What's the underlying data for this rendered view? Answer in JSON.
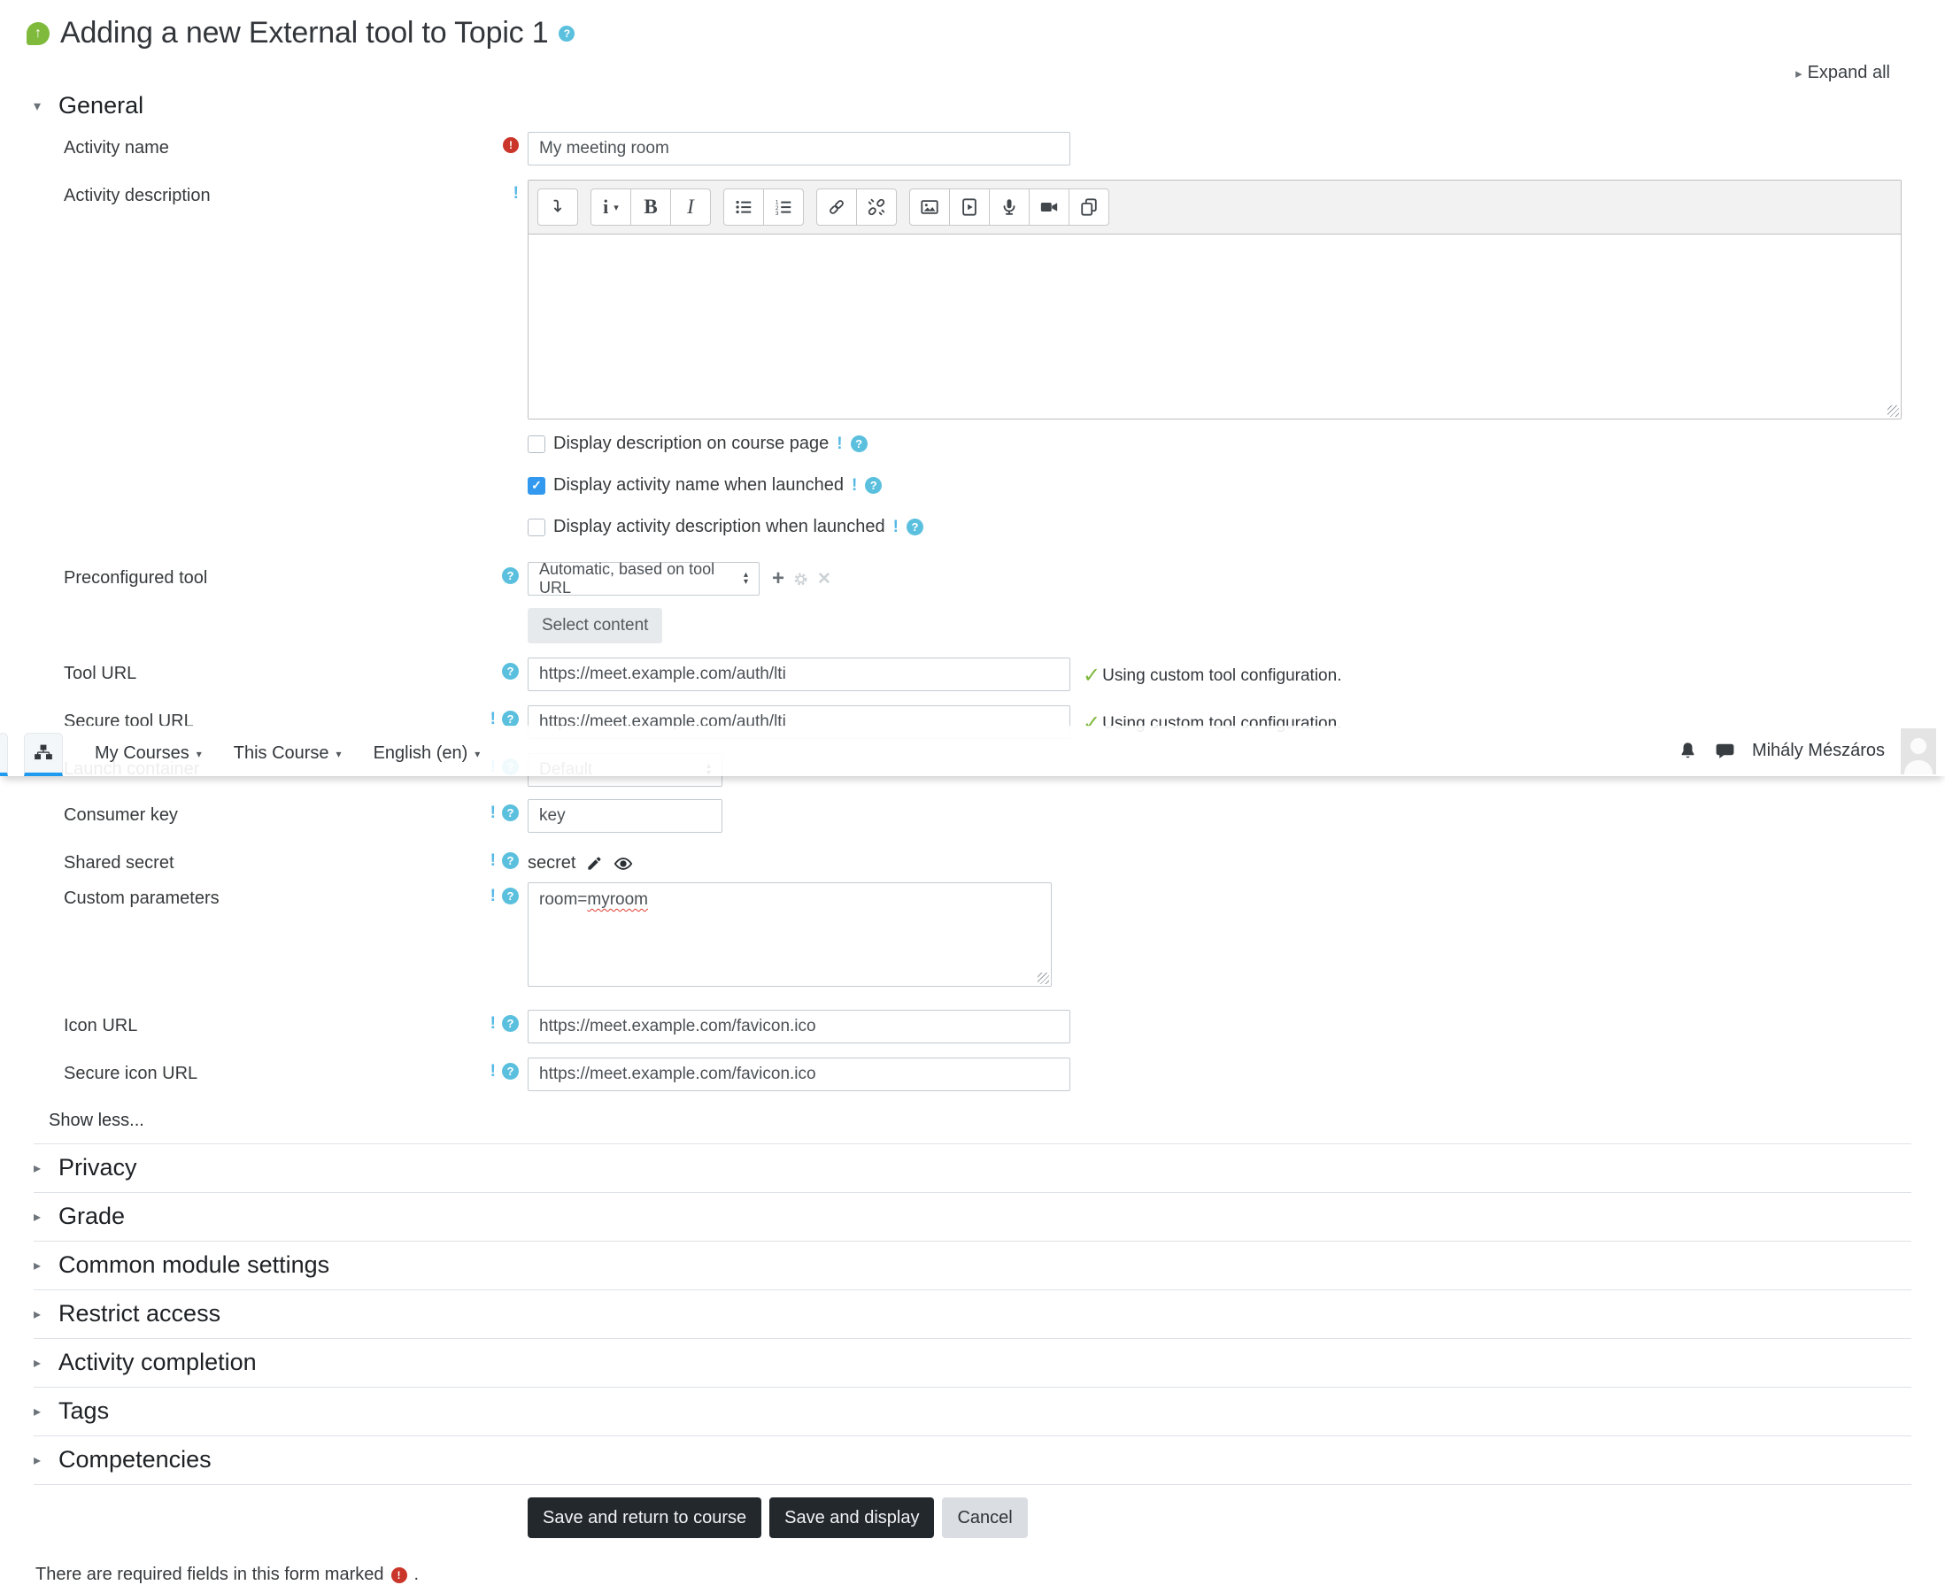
{
  "page": {
    "title": "Adding a new External tool to Topic 1",
    "expand_all": "Expand all",
    "show_less": "Show less...",
    "footer_required_prefix": "There are required fields in this form marked",
    "footer_suffix": "."
  },
  "icons": {
    "help": "?",
    "required": "!",
    "more": "!",
    "check": "✓",
    "checkbox_check": "✓",
    "plus": "+",
    "close": "✕",
    "caret": "▾",
    "triangle_collapsed": "▸",
    "triangle_expanded": "▾",
    "arrow_up_small": "▴",
    "arrow_down_small": "▾",
    "module_arrow": "↑"
  },
  "navbar": {
    "menus": [
      {
        "label": "My Courses"
      },
      {
        "label": "This Course"
      },
      {
        "label": "English (en)"
      }
    ],
    "user_name": "Mihály Mészáros"
  },
  "general": {
    "heading": "General",
    "activity_name": {
      "label": "Activity name",
      "value": "My meeting room"
    },
    "activity_description": {
      "label": "Activity description"
    },
    "editor": {
      "bold_glyph": "B",
      "italic_glyph": "I",
      "style_glyph": "i",
      "toolbar_icons": [
        "toggle-toolbar",
        "text-style",
        "bold",
        "italic",
        "unordered-list",
        "ordered-list",
        "link",
        "unlink",
        "image",
        "media",
        "record-audio",
        "record-video",
        "manage-files"
      ]
    },
    "checkboxes": [
      {
        "label": "Display description on course page",
        "checked": false
      },
      {
        "label": "Display activity name when launched",
        "checked": true
      },
      {
        "label": "Display activity description when launched",
        "checked": false
      }
    ],
    "preconfigured_tool": {
      "label": "Preconfigured tool",
      "value": "Automatic, based on tool URL",
      "select_content_label": "Select content"
    },
    "tool_url": {
      "label": "Tool URL",
      "value": "https://meet.example.com/auth/lti",
      "status": "Using custom tool configuration."
    },
    "secure_tool_url": {
      "label": "Secure tool URL",
      "value": "https://meet.example.com/auth/lti",
      "status": "Using custom tool configuration."
    },
    "launch_container": {
      "label": "Launch container",
      "value": "Default"
    },
    "consumer_key": {
      "label": "Consumer key",
      "value": "key"
    },
    "shared_secret": {
      "label": "Shared secret",
      "value": "secret"
    },
    "custom_parameters": {
      "label": "Custom parameters",
      "value_plain": "room=",
      "value_misspelled": "myroom"
    },
    "icon_url": {
      "label": "Icon URL",
      "value": "https://meet.example.com/favicon.ico"
    },
    "secure_icon_url": {
      "label": "Secure icon URL",
      "value": "https://meet.example.com/favicon.ico"
    }
  },
  "sections": [
    {
      "label": "Privacy"
    },
    {
      "label": "Grade"
    },
    {
      "label": "Common module settings"
    },
    {
      "label": "Restrict access"
    },
    {
      "label": "Activity completion"
    },
    {
      "label": "Tags"
    },
    {
      "label": "Competencies"
    }
  ],
  "actions": {
    "save_return": "Save and return to course",
    "save_display": "Save and display",
    "cancel": "Cancel"
  },
  "colors": {
    "accent_blue": "#1e9bf0",
    "checkbox_blue": "#3399ee",
    "help_cyan": "#5bc0de",
    "required_red": "#ca3629",
    "success_green": "#7db83d",
    "module_green": "#7fba3d",
    "button_dark": "#23282d"
  }
}
